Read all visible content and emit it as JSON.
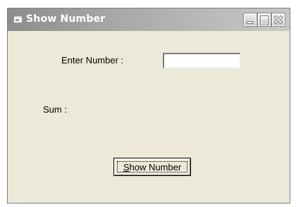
{
  "window": {
    "title": "Show Number"
  },
  "titlebar_buttons": {
    "minimize": "minimize-icon",
    "maximize": "maximize-icon",
    "close": "close-icon"
  },
  "form": {
    "enter_label": "Enter Number :",
    "number_value": "",
    "sum_label": "Sum :",
    "button_label_mnemonic": "S",
    "button_label_rest": "how Number"
  }
}
